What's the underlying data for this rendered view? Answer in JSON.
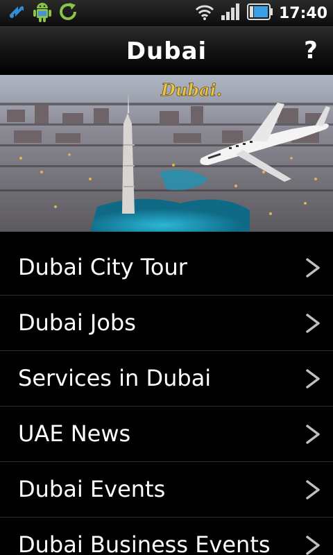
{
  "status_bar": {
    "time": "17:40",
    "icons": [
      "usb-debug-icon",
      "android-icon",
      "sync-icon",
      "wifi-icon",
      "signal-icon",
      "battery-icon"
    ]
  },
  "header": {
    "title": "Dubai",
    "help_label": "?"
  },
  "banner": {
    "caption": "Dubai."
  },
  "menu": {
    "items": [
      {
        "label": "Dubai City Tour"
      },
      {
        "label": "Dubai Jobs"
      },
      {
        "label": "Services in Dubai"
      },
      {
        "label": "UAE News"
      },
      {
        "label": "Dubai Events"
      },
      {
        "label": "Dubai Business Events"
      }
    ],
    "chevron_glyph": ">"
  },
  "colors": {
    "background": "#000000",
    "text": "#ffffff",
    "chevron": "#bfbfbf",
    "banner_caption": "#e8c44a"
  }
}
